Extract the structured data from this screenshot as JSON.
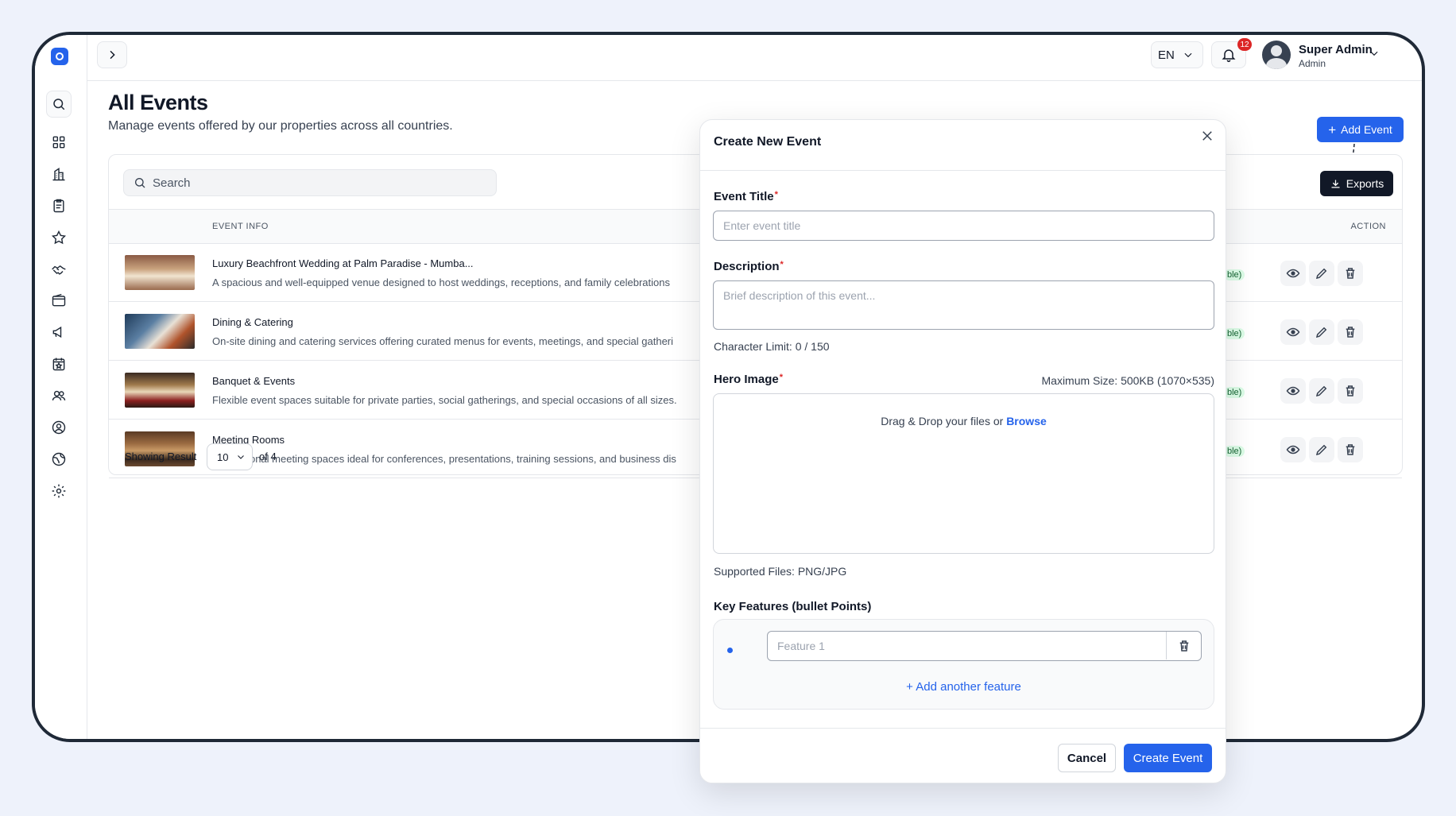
{
  "header": {
    "language": "EN",
    "notification_count": "12",
    "user_name": "Super Admin",
    "user_role": "Admin"
  },
  "page": {
    "title": "All Events",
    "subtitle": "Manage events offered by our properties across all countries.",
    "add_event_label": "Add Event",
    "search_placeholder": "Search",
    "exports_label": "Exports"
  },
  "table": {
    "col_event_info": "EVENT INFO",
    "col_action": "ACTION",
    "rows": [
      {
        "title": "Luxury Beachfront Wedding at Palm Paradise - Mumba...",
        "description": "A spacious and well-equipped venue designed to host weddings, receptions, and family celebrations",
        "status_fragment": "ble)"
      },
      {
        "title": "Dining & Catering",
        "description": "On-site dining and catering services offering curated menus for events, meetings, and special gatheri",
        "status_fragment": "ble)"
      },
      {
        "title": "Banquet & Events",
        "description": "Flexible event spaces suitable for private parties, social gatherings, and special occasions of all sizes.",
        "status_fragment": "ble)"
      },
      {
        "title": "Meeting Rooms",
        "description": "Professional meeting spaces ideal for conferences, presentations, training sessions, and business dis",
        "status_fragment": "ble)"
      }
    ],
    "showing_label": "Showing Result",
    "per_page": "10",
    "total_label": "of 4"
  },
  "modal": {
    "title": "Create New Event",
    "event_title_label": "Event Title",
    "event_title_placeholder": "Enter event title",
    "description_label": "Description",
    "description_placeholder": "Brief description of this event...",
    "char_limit": "Character Limit: 0 / 150",
    "hero_image_label": "Hero Image",
    "max_size": "Maximum Size: 500KB (1070×535)",
    "dropzone_text": "Drag & Drop your files or",
    "browse_label": "Browse",
    "supported_files": "Supported Files: PNG/JPG",
    "key_features_label": "Key Features (bullet Points)",
    "feature_placeholder": "Feature 1",
    "add_feature_label": "Add another feature",
    "cancel_label": "Cancel",
    "create_label": "Create Event"
  },
  "colors": {
    "primary": "#2563eb",
    "dark": "#111827",
    "badge": "#dc2626"
  },
  "icons": [
    "search-icon",
    "grid-icon",
    "building-icon",
    "clipboard-icon",
    "star-icon",
    "handshake-icon",
    "wallet-icon",
    "megaphone-icon",
    "calendar-star-icon",
    "users-icon",
    "user-circle-icon",
    "globe-icon",
    "gear-icon"
  ]
}
